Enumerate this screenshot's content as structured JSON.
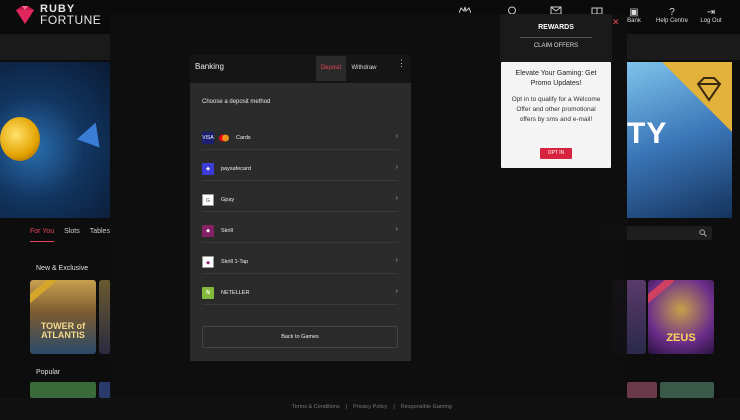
{
  "header": {
    "logo_top": "RUBY",
    "logo_bottom": "FORTUNE",
    "right_items": [
      {
        "icon": "bank-icon",
        "label": "Bank"
      },
      {
        "icon": "help-icon",
        "label": "Help Centre"
      },
      {
        "icon": "logout-icon",
        "label": "Log Out"
      }
    ]
  },
  "hero": {
    "right_text": "TY"
  },
  "categories": {
    "tabs": [
      {
        "label": "For You",
        "active": true
      },
      {
        "label": "Slots",
        "active": false
      },
      {
        "label": "Tables",
        "active": false
      }
    ]
  },
  "sections": {
    "new_exclusive": "New & Exclusive",
    "popular": "Popular"
  },
  "tiles": {
    "atlantis_label": "TOWER of ATLANTIS",
    "zeus_label": "ZEUS"
  },
  "footer": {
    "links": [
      "Terms & Conditions",
      "|",
      "Privacy Policy",
      "|",
      "Responsible Gaming"
    ]
  },
  "banking": {
    "title": "Banking",
    "tab_deposit": "Deposit",
    "tab_withdraw": "Withdraw",
    "menu_glyph": "⋮",
    "subtitle": "Choose a deposit method",
    "methods": [
      {
        "label": "Cards",
        "icon": "card-icon",
        "color": "#1a1f71"
      },
      {
        "label": "paysafecard",
        "icon": "paysafecard-icon",
        "color": "#3b3bd6"
      },
      {
        "label": "Gpay",
        "icon": "gpay-icon",
        "color": "#ffffff"
      },
      {
        "label": "Skrill",
        "icon": "skrill-icon",
        "color": "#862165"
      },
      {
        "label": "Skrill 1-Tap",
        "icon": "skrill-1tap-icon",
        "color": "#862165"
      },
      {
        "label": "NETELLER",
        "icon": "neteller-icon",
        "color": "#83ba3b"
      }
    ],
    "back_button": "Back to Games"
  },
  "rewards": {
    "title": "REWARDS",
    "claim": "CLAIM OFFERS",
    "close": "✕",
    "card_heading": "Elevate Your Gaming: Get Promo Updates!",
    "card_body": "Opt in to qualify for a Welcome Offer and other promotional offers by sms and e-mail!",
    "button": "OPT IN"
  },
  "colors": {
    "accent": "#e8455a",
    "optin_button": "#d8233e"
  }
}
